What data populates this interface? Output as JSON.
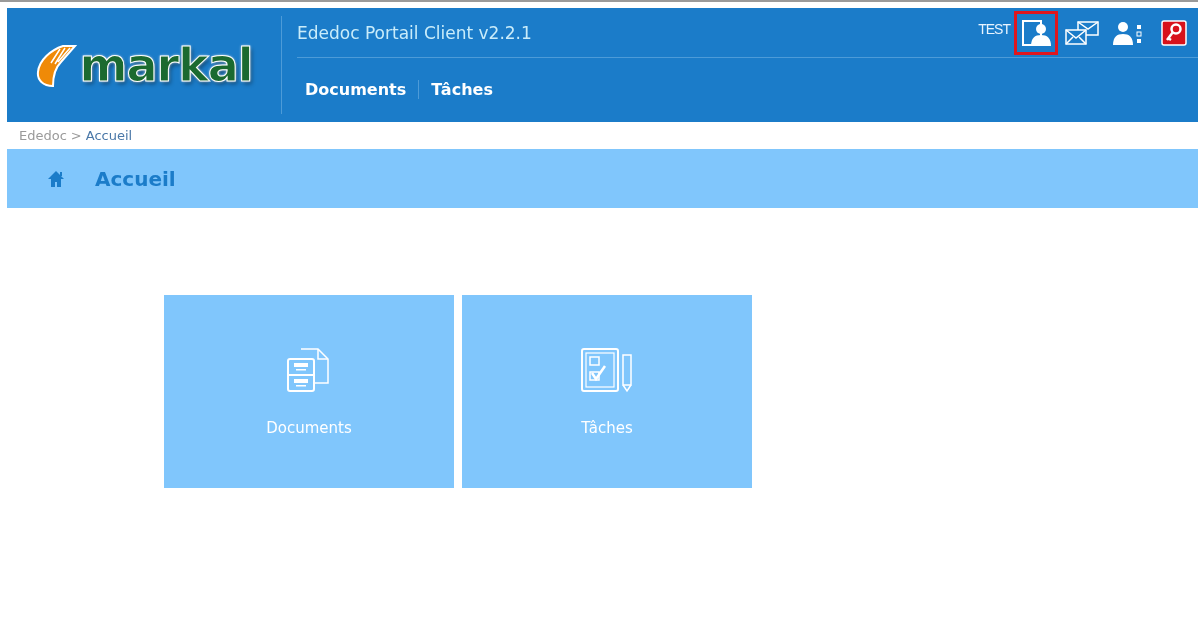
{
  "logo": {
    "text": "markal"
  },
  "header": {
    "title": "Ededoc Portail Client v2.2.1",
    "user": "TEST",
    "icons": [
      {
        "kind": "profile",
        "selected": true
      },
      {
        "kind": "mail",
        "selected": false
      },
      {
        "kind": "users",
        "selected": false
      },
      {
        "kind": "logout",
        "selected": false
      }
    ]
  },
  "nav": [
    {
      "label": "Documents"
    },
    {
      "label": "Tâches"
    }
  ],
  "breadcrumb": {
    "root": "Ededoc",
    "separator": ">",
    "current": "Accueil"
  },
  "page_title": "Accueil",
  "tiles": [
    {
      "kind": "documents",
      "label": "Documents"
    },
    {
      "kind": "tasks",
      "label": "Tâches"
    }
  ]
}
